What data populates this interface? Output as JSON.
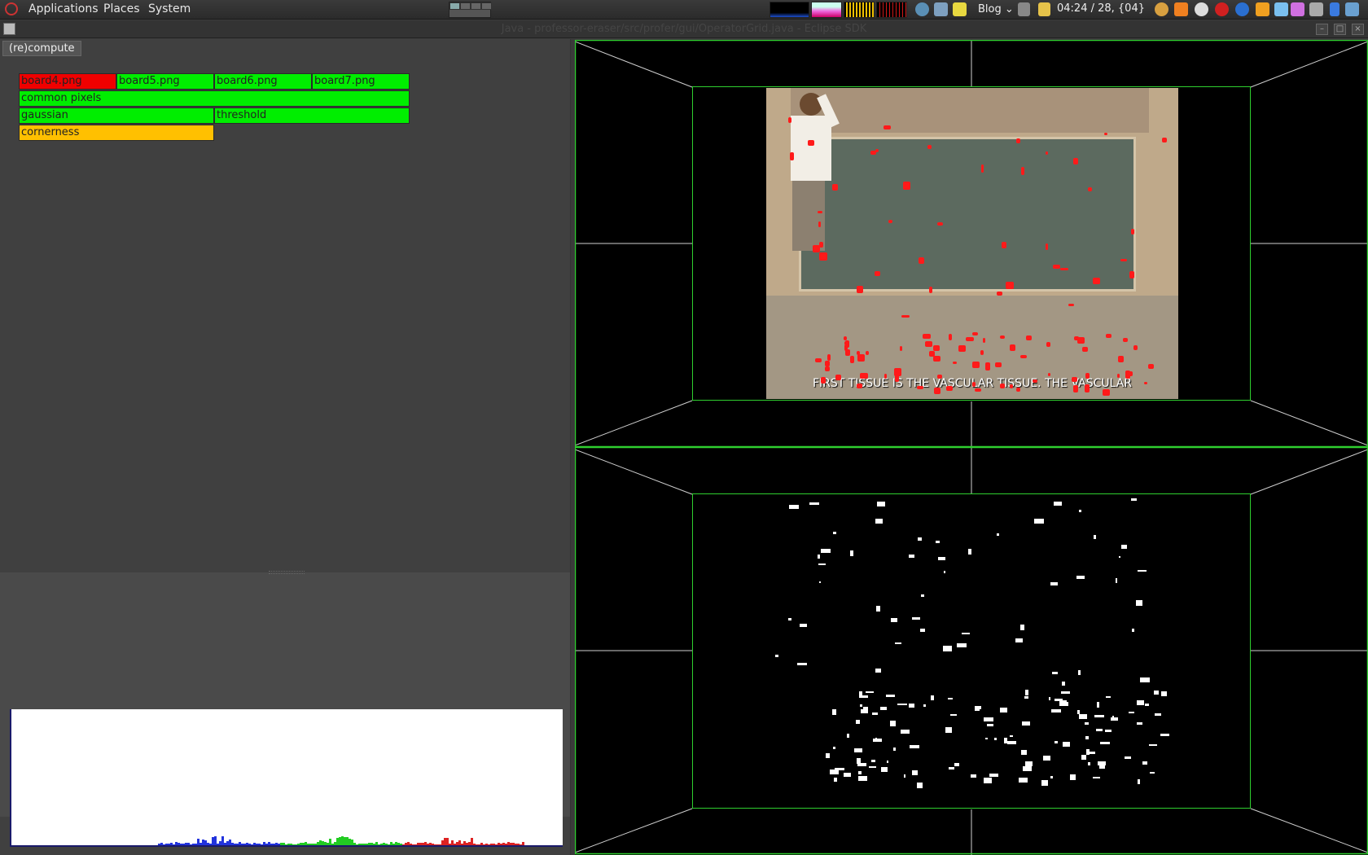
{
  "panel": {
    "menus": [
      "Applications",
      "Places",
      "System"
    ],
    "blog_label": "Blog",
    "clock": "04:24 / 28, {04}"
  },
  "window": {
    "title": "Java - professor-eraser/src/profer/gui/OperatorGrid.java - Eclipse SDK"
  },
  "toolbar": {
    "recompute_label": "(re)compute"
  },
  "operators": [
    {
      "label": "board4.png",
      "status": "red"
    },
    {
      "label": "board5.png",
      "status": "green"
    },
    {
      "label": "board6.png",
      "status": "green"
    },
    {
      "label": "board7.png",
      "status": "green"
    },
    {
      "label": "common pixels",
      "status": "green"
    },
    {
      "label": "gaussian",
      "status": "green"
    },
    {
      "label": "threshold",
      "status": "green"
    },
    {
      "label": "cornerness",
      "status": "orange"
    }
  ],
  "viewer": {
    "subtitle": "FIRST TISSUE IS THE VASCULAR TISSUE. THE VASCULAR"
  },
  "colors": {
    "ok": "#00ee00",
    "error": "#f00000",
    "pending": "#ffc000",
    "frame": "#2fcf2f"
  }
}
